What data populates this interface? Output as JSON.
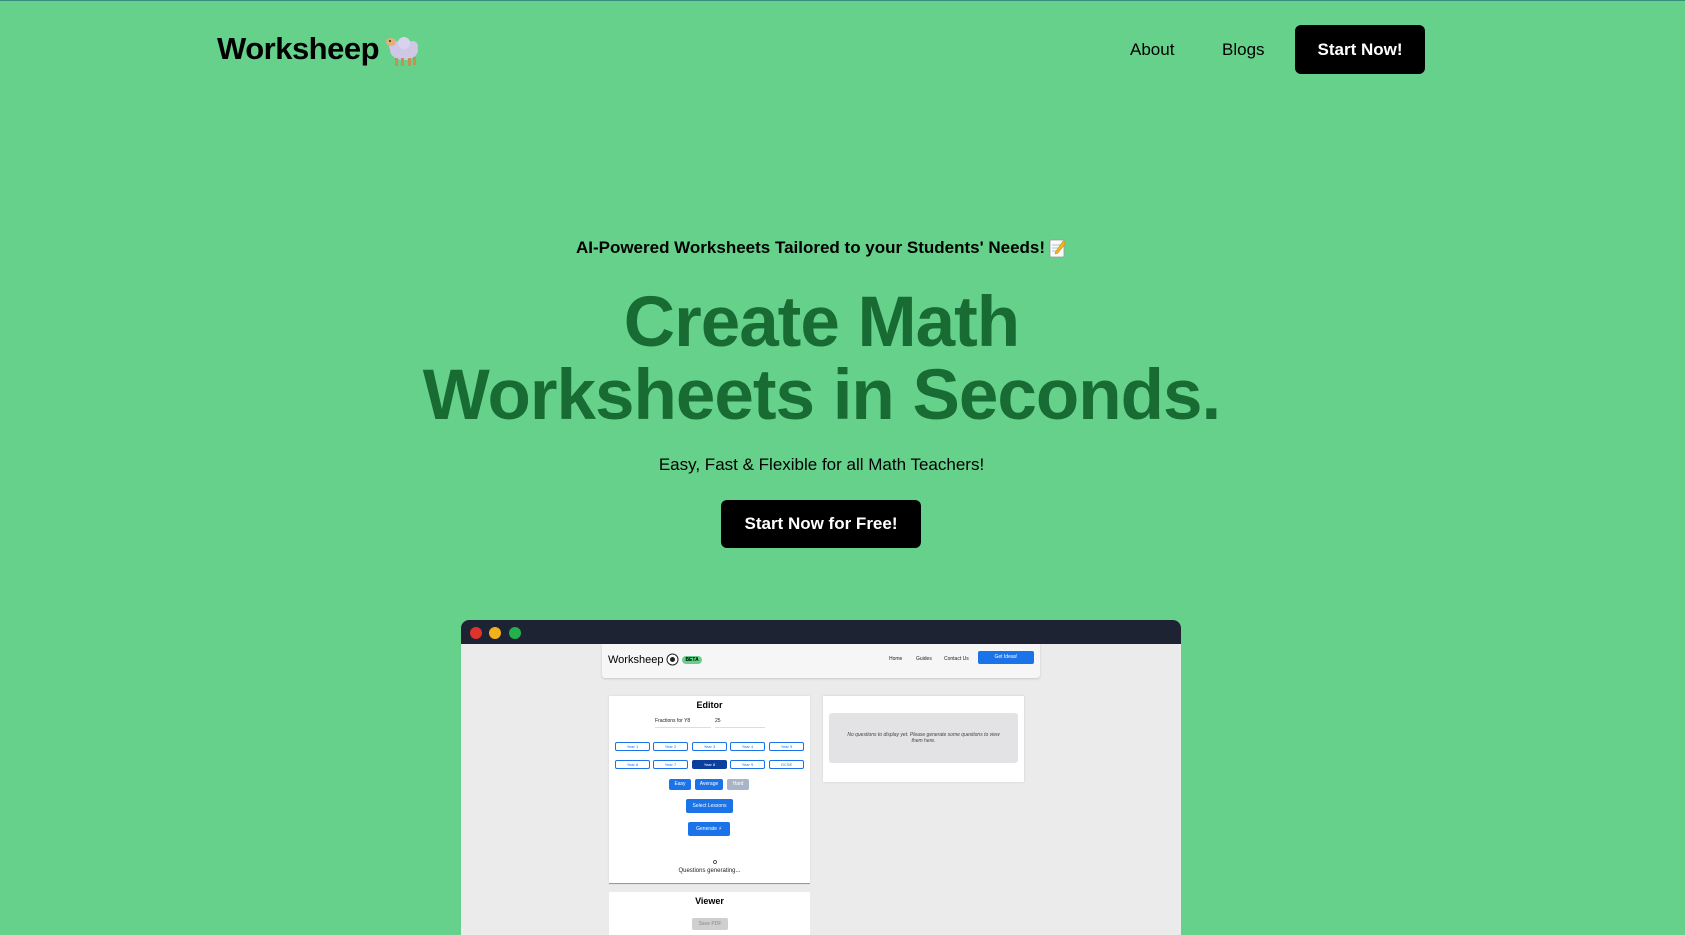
{
  "nav": {
    "logo_text": "Worksheep",
    "logo_icon": "sheep-icon",
    "about_label": "About",
    "blogs_label": "Blogs",
    "start_label": "Start Now!"
  },
  "hero": {
    "tagline": "AI-Powered Worksheets Tailored to your Students' Needs!",
    "tagline_icon": "memo-icon",
    "headline_line1": "Create Math",
    "headline_line2": "Worksheets in Seconds.",
    "subline": "Easy, Fast & Flexible for all Math Teachers!",
    "cta_label": "Start Now for Free!"
  },
  "preview": {
    "nav": {
      "logo_text": "Worksheep",
      "beta_label": "BETA",
      "home": "Home",
      "guides": "Guides",
      "contact": "Contact Us",
      "button": "Get Ideas!"
    },
    "editor": {
      "title": "Editor",
      "topic_value": "Fractions for Y8",
      "count_value": "25",
      "years_row1": [
        "Year 1",
        "Year 2",
        "Year 3",
        "Year 4",
        "Year 5"
      ],
      "years_row2": [
        "Year 6",
        "Year 7",
        "Year 8",
        "Year 9",
        "GCSE"
      ],
      "active_year": "Year 8",
      "difficulty": [
        "Easy",
        "Average",
        "Hard"
      ],
      "select_lessons": "Select Lessons",
      "generate": "Generate ⚡",
      "status": "Questions generating..."
    },
    "viewer": {
      "title": "Viewer",
      "save_pdf": "Save PDF"
    },
    "results": {
      "empty_message": "No questions to display yet. Please generate some questions to view them here."
    }
  },
  "colors": {
    "background": "#66d18a",
    "headline": "#176b33",
    "button": "#000000",
    "accent_blue": "#1a73e8"
  }
}
